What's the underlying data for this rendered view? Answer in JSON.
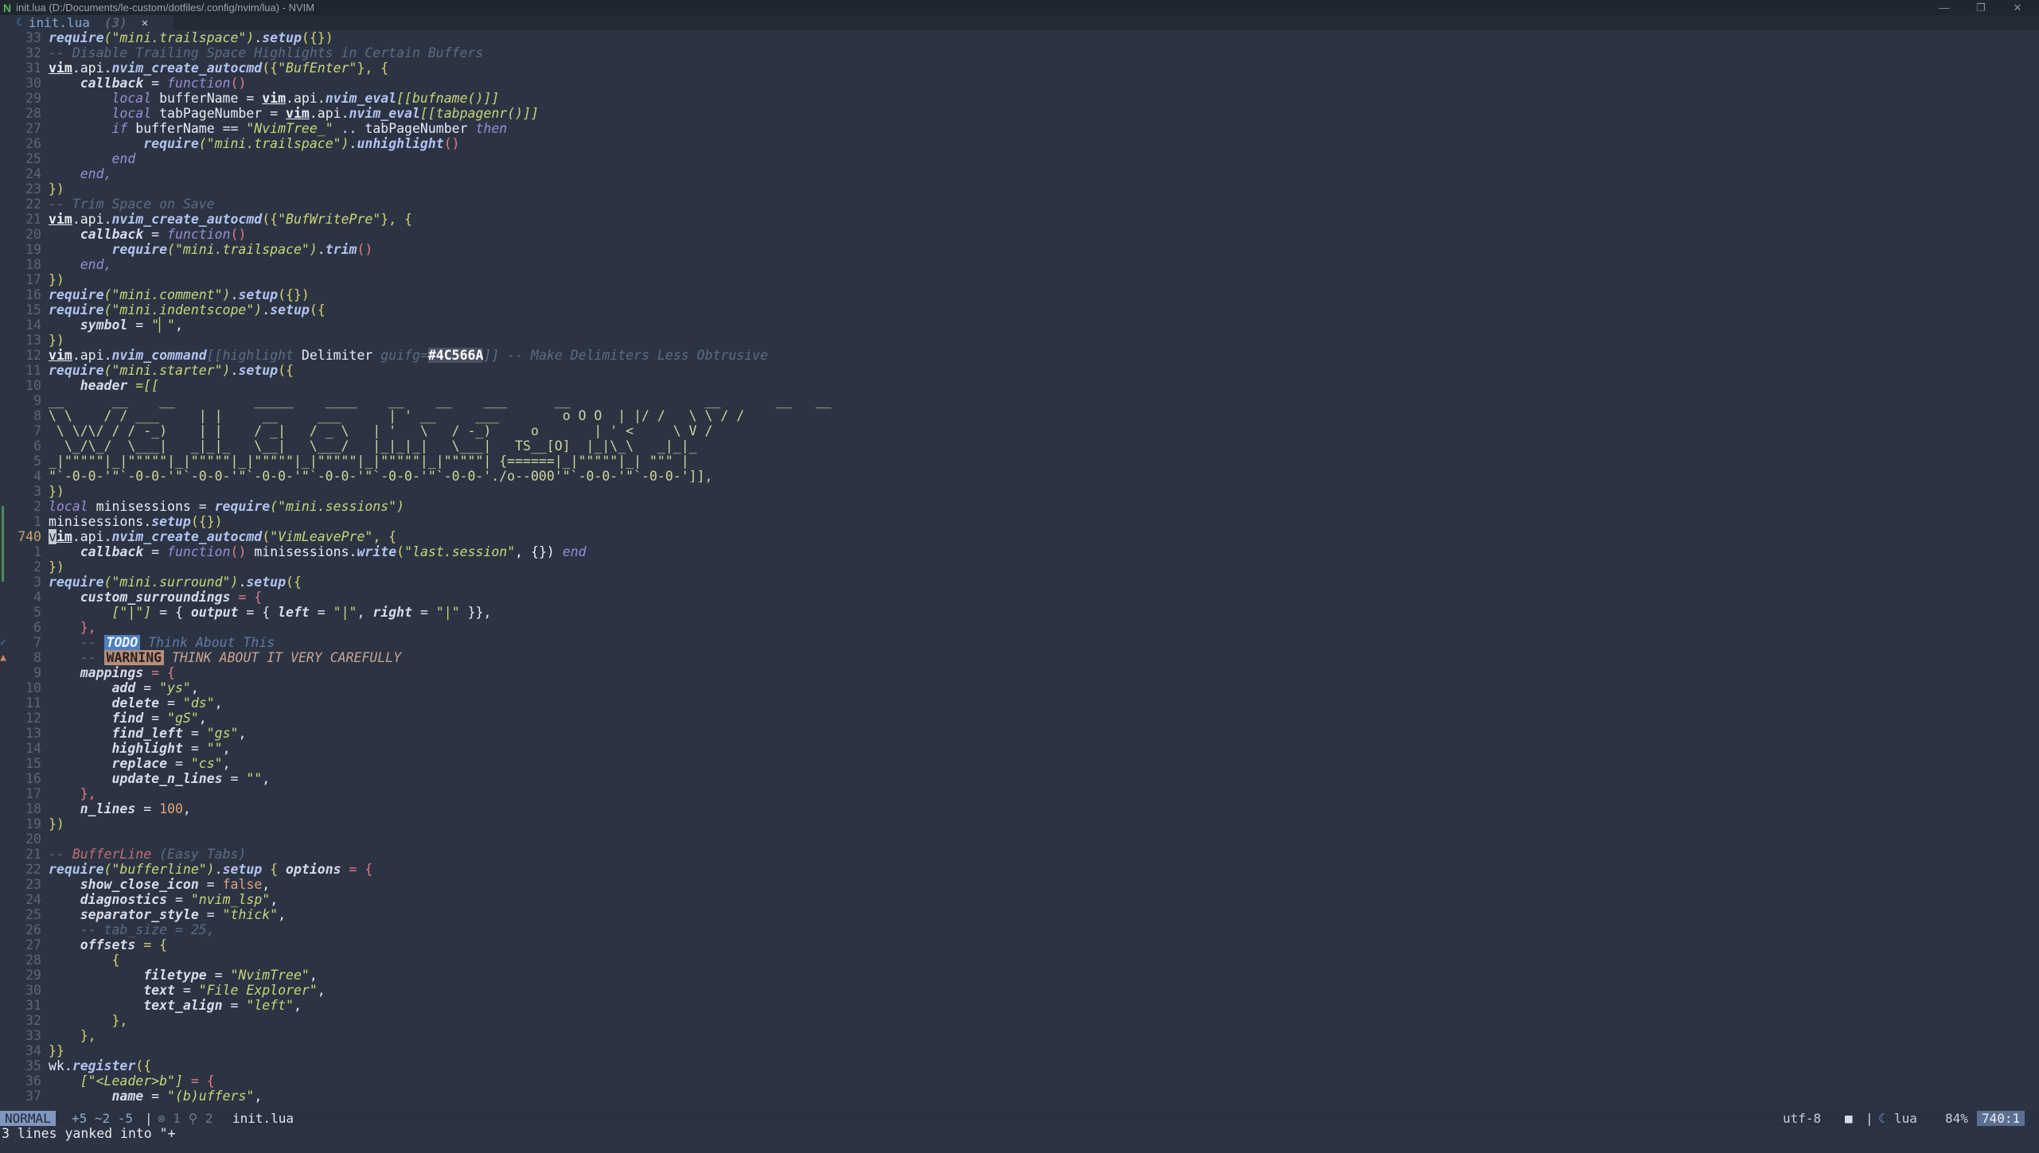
{
  "window": {
    "title": "init.lua (D:/Documents/le-custom/dotfiles/.config/nvim/lua) - NVIM",
    "controls": {
      "minimize": "—",
      "maximize": "❐",
      "close": "✕"
    }
  },
  "tab": {
    "name": "init.lua",
    "count": "(3)",
    "close": "✕"
  },
  "gutter": {
    "lines": [
      {
        "n": "33"
      },
      {
        "n": "32"
      },
      {
        "n": "31"
      },
      {
        "n": "30"
      },
      {
        "n": "29"
      },
      {
        "n": "28"
      },
      {
        "n": "27"
      },
      {
        "n": "26"
      },
      {
        "n": "25"
      },
      {
        "n": "24"
      },
      {
        "n": "23"
      },
      {
        "n": "22"
      },
      {
        "n": "21"
      },
      {
        "n": "20"
      },
      {
        "n": "19"
      },
      {
        "n": "18"
      },
      {
        "n": "17"
      },
      {
        "n": "16"
      },
      {
        "n": "15"
      },
      {
        "n": "14"
      },
      {
        "n": "13"
      },
      {
        "n": "12"
      },
      {
        "n": "11"
      },
      {
        "n": "10"
      },
      {
        "n": "9"
      },
      {
        "n": "8"
      },
      {
        "n": "7"
      },
      {
        "n": "6"
      },
      {
        "n": "5"
      },
      {
        "n": "4"
      },
      {
        "n": "3"
      },
      {
        "n": "2"
      },
      {
        "n": "1"
      },
      {
        "n": "740"
      },
      {
        "n": "1"
      },
      {
        "n": "2"
      },
      {
        "n": "3"
      },
      {
        "n": "4"
      },
      {
        "n": "5"
      },
      {
        "n": "6"
      },
      {
        "n": "7"
      },
      {
        "n": "8"
      },
      {
        "n": "9"
      },
      {
        "n": "10"
      },
      {
        "n": "11"
      },
      {
        "n": "12"
      },
      {
        "n": "13"
      },
      {
        "n": "14"
      },
      {
        "n": "15"
      },
      {
        "n": "16"
      },
      {
        "n": "17"
      },
      {
        "n": "18"
      },
      {
        "n": "19"
      },
      {
        "n": "20"
      },
      {
        "n": "21"
      },
      {
        "n": "22"
      },
      {
        "n": "23"
      },
      {
        "n": "24"
      },
      {
        "n": "25"
      },
      {
        "n": "26"
      },
      {
        "n": "27"
      },
      {
        "n": "28"
      },
      {
        "n": "29"
      },
      {
        "n": "30"
      },
      {
        "n": "31"
      },
      {
        "n": "32"
      },
      {
        "n": "33"
      },
      {
        "n": "34"
      },
      {
        "n": "35"
      },
      {
        "n": "36"
      },
      {
        "n": "37"
      }
    ],
    "signs": {
      "todo": "✓",
      "warning": "▲"
    }
  },
  "code": {
    "l0": [
      "require",
      "(\"mini.trailspace\")",
      ".",
      "setup",
      "({})"
    ],
    "l1": "-- Disable Trailing Space Highlights in Certain Buffers",
    "l2": [
      "vim",
      ".api.",
      "nvim_create_autocmd",
      "({",
      "\"BufEnter\"",
      "}, {"
    ],
    "l3": [
      "callback",
      " = ",
      "function",
      "()"
    ],
    "l4": [
      "local",
      " bufferName = ",
      "vim",
      ".api.",
      "nvim_eval",
      "[[bufname()]]"
    ],
    "l5": [
      "local",
      " tabPageNumber = ",
      "vim",
      ".api.",
      "nvim_eval",
      "[[tabpagenr()]]"
    ],
    "l6": [
      "if",
      " bufferName == ",
      "\"NvimTree_\"",
      " .. tabPageNumber ",
      "then"
    ],
    "l7": [
      "require",
      "(\"mini.trailspace\")",
      ".",
      "unhighlight",
      "()"
    ],
    "l8": "end",
    "l9": "end,",
    "l10": "})",
    "l11": "-- Trim Space on Save",
    "l12": [
      "vim",
      ".api.",
      "nvim_create_autocmd",
      "({",
      "\"BufWritePre\"",
      "}, {"
    ],
    "l13": [
      "callback",
      " = ",
      "function",
      "()"
    ],
    "l14": [
      "require",
      "(\"mini.trailspace\")",
      ".",
      "trim",
      "()"
    ],
    "l15": "end,",
    "l16": "})",
    "l17": [
      "require",
      "(\"mini.comment\")",
      ".",
      "setup",
      "({})"
    ],
    "l18": [
      "require",
      "(\"mini.indentscope\")",
      ".",
      "setup",
      "({"
    ],
    "l19": [
      "symbol",
      " = ",
      "\"▏\"",
      ","
    ],
    "l20": "})",
    "l21": [
      "vim",
      ".api.",
      "nvim_command",
      "[[highlight ",
      "Delimiter",
      " guifg=",
      "#4C566A",
      "]]",
      " -- Make Delimiters Less Obtrusive"
    ],
    "l22": [
      "require",
      "(\"mini.starter\")",
      ".",
      "setup",
      "({"
    ],
    "l23": [
      "header",
      " =[["
    ],
    "l24": "__      __    __          _____    ____    __    __    ___      __                 __       __   __    ",
    "l25": "\\ \\    / / ___     | |     __     ___      | ' __     ___        o O O  | |/ /   \\ \\ / /",
    "l26": " \\ \\/\\/ / / -_)    | |    / _|   / _ \\   | '   \\   / -_)     o       | ' <     \\ V / ",
    "l27": "  \\_/\\_/  \\___|   _|_|_   \\__|   \\___/   |_|_|_|   \\___|   TS__[O]  |_|\\_\\   _|_|_ ",
    "l28": "_|\"\"\"\"\"|_|\"\"\"\"\"|_|\"\"\"\"\"|_|\"\"\"\"\"|_|\"\"\"\"\"|_|\"\"\"\"\"|_|\"\"\"\"\"| {======|_|\"\"\"\"\"|_| \"\"\" |",
    "l29": "\"`-0-0-'\"`-0-0-'\"`-0-0-'\"`-0-0-'\"`-0-0-'\"`-0-0-'\"`-0-0-'./o--000'\"`-0-0-'\"`-0-0-']],",
    "l30": "})",
    "l31": [
      "local",
      " minisessions = ",
      "require",
      "(\"mini.sessions\")"
    ],
    "l32": [
      "minisessions",
      ".",
      "setup",
      "({})"
    ],
    "l33": [
      "v",
      "im",
      ".api.",
      "nvim_create_autocmd",
      "(",
      "\"VimLeavePre\"",
      ", {"
    ],
    "l34": [
      "callback",
      " = ",
      "function",
      "()",
      " minisessions.",
      "write",
      "(",
      "\"last.session\"",
      ", {}) ",
      "end"
    ],
    "l35": "})",
    "l36": [
      "require",
      "(\"mini.surround\")",
      ".",
      "setup",
      "({"
    ],
    "l37": [
      "custom_surroundings",
      " = {"
    ],
    "l38": [
      "[\"|\"]",
      " = { ",
      "output",
      " = { ",
      "left",
      " = ",
      "\"|\"",
      ", ",
      "right",
      " = ",
      "\"|\"",
      " }},"
    ],
    "l39": "},",
    "l40": [
      "-- ",
      "TODO",
      " Think About This"
    ],
    "l41": [
      "-- ",
      "WARNING",
      " THINK ABOUT IT VERY CAREFULLY"
    ],
    "l42": [
      "mappings",
      " = {"
    ],
    "l43": [
      "add",
      " = ",
      "\"ys\"",
      ","
    ],
    "l44": [
      "delete",
      " = ",
      "\"ds\"",
      ","
    ],
    "l45": [
      "find",
      " = ",
      "\"gS\"",
      ","
    ],
    "l46": [
      "find_left",
      " = ",
      "\"gs\"",
      ","
    ],
    "l47": [
      "highlight",
      " = ",
      "\"\"",
      ","
    ],
    "l48": [
      "replace",
      " = ",
      "\"cs\"",
      ","
    ],
    "l49": [
      "update_n_lines",
      " = ",
      "\"\"",
      ","
    ],
    "l50": "},",
    "l51": [
      "n_lines",
      " = ",
      "100",
      ","
    ],
    "l52": "})",
    "l53": "",
    "l54": [
      "-- ",
      "BufferLine",
      " (Easy Tabs)"
    ],
    "l55": [
      "require",
      "(\"bufferline\")",
      ".",
      "setup",
      " { ",
      "options",
      " = {"
    ],
    "l56": [
      "show_close_icon",
      " = ",
      "false",
      ","
    ],
    "l57": [
      "diagnostics",
      " = ",
      "\"nvim_lsp\"",
      ","
    ],
    "l58": [
      "separator_style",
      " = ",
      "\"thick\"",
      ","
    ],
    "l59": "-- tab_size = 25,",
    "l60": [
      "offsets",
      " = {"
    ],
    "l61": "{",
    "l62": [
      "filetype",
      " = ",
      "\"NvimTree\"",
      ","
    ],
    "l63": [
      "text",
      " = ",
      "\"File Explorer\"",
      ","
    ],
    "l64": [
      "text_align",
      " = ",
      "\"left\"",
      ","
    ],
    "l65": "},",
    "l66": "},",
    "l67": "}}",
    "l68": [
      "wk",
      ".",
      "register",
      "({"
    ],
    "l69": [
      "[\"<Leader>b\"]",
      " = {"
    ],
    "l70": [
      "name",
      " = ",
      "\"(b)uffers\"",
      ","
    ]
  },
  "statusline": {
    "mode": "NORMAL",
    "git_diff": "+5 ~2 -5",
    "separator": "|",
    "diagnostics": "⊗ 1 ⚲ 2",
    "filename": "init.lua",
    "encoding": "utf-8",
    "os_icon": "■",
    "filetype_icon": "☾",
    "filetype": "lua",
    "percent": "84%",
    "position": "740:1"
  },
  "cmdline": {
    "text": "3 lines yanked into \"+"
  }
}
